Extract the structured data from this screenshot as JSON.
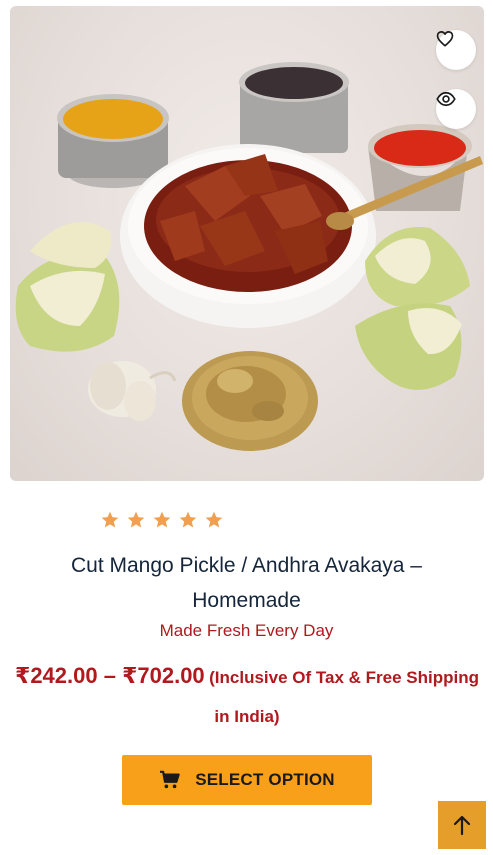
{
  "product": {
    "image_alt": "Cut Mango Pickle bowl with mango pieces, spices, garlic and fenugreek seeds",
    "rating": 5,
    "title": "Cut Mango Pickle / Andhra Avakaya – Homemade",
    "subtitle": "Made Fresh Every Day",
    "price_range": "₹242.00 – ₹702.00",
    "price_note": "(Inclusive Of Tax & Free Shipping in India)",
    "select_label": "SELECT OPTION"
  },
  "icons": {
    "wishlist": "heart-icon",
    "quickview": "eye-icon",
    "cart": "cart-icon",
    "scroll_top": "arrow-up-icon"
  },
  "colors": {
    "title": "#15263b",
    "accent_red": "#b0191e",
    "button": "#f9a01b",
    "star": "#f0a050",
    "scroll_top": "#e59e2a"
  }
}
